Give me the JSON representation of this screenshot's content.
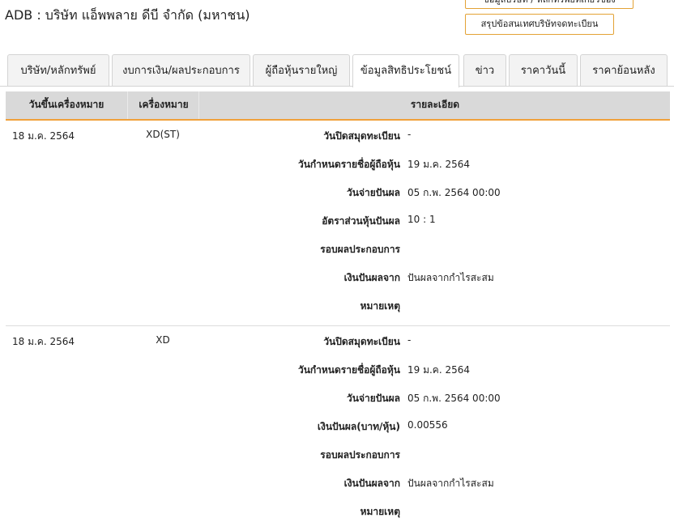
{
  "header": {
    "title": "ADB : บริษัท แอ็พพลาย ดีบี จำกัด (มหาชน)",
    "button_top": "ข้อมูลบริษัท / หลักทรัพย์ที่เกี่ยวข้อง",
    "button_summary": "สรุปข้อสนเทศบริษัทจดทะเบียน"
  },
  "tabs": [
    {
      "label": "บริษัท/หลักทรัพย์"
    },
    {
      "label": "งบการเงิน/ผลประกอบการ"
    },
    {
      "label": "ผู้ถือหุ้นรายใหญ่"
    },
    {
      "label": "ข้อมูลสิทธิประโยชน์",
      "active": true
    },
    {
      "label": "ข่าว"
    },
    {
      "label": "ราคาวันนี้"
    },
    {
      "label": "ราคาย้อนหลัง"
    }
  ],
  "table": {
    "headers": [
      "วันขึ้นเครื่องหมาย",
      "เครื่องหมาย",
      "รายละเอียด"
    ],
    "records": [
      {
        "date": "18 ม.ค. 2564",
        "symbol": "XD(ST)",
        "details": [
          {
            "label": "วันปิดสมุดทะเบียน",
            "value": "-"
          },
          {
            "label": "วันกำหนดรายชื่อผู้ถือหุ้น",
            "value": "19 ม.ค. 2564"
          },
          {
            "label": "วันจ่ายปันผล",
            "value": "05 ก.พ. 2564 00:00"
          },
          {
            "label": "อัตราส่วนหุ้นปันผล",
            "value": "10 : 1"
          },
          {
            "label": "รอบผลประกอบการ",
            "value": ""
          },
          {
            "label": "เงินปันผลจาก",
            "value": "ปันผลจากกำไรสะสม"
          },
          {
            "label": "หมายเหตุ",
            "value": ""
          }
        ]
      },
      {
        "date": "18 ม.ค. 2564",
        "symbol": "XD",
        "details": [
          {
            "label": "วันปิดสมุดทะเบียน",
            "value": "-"
          },
          {
            "label": "วันกำหนดรายชื่อผู้ถือหุ้น",
            "value": "19 ม.ค. 2564"
          },
          {
            "label": "วันจ่ายปันผล",
            "value": "05 ก.พ. 2564 00:00"
          },
          {
            "label": "เงินปันผล(บาท/หุ้น)",
            "value": "0.00556"
          },
          {
            "label": "รอบผลประกอบการ",
            "value": ""
          },
          {
            "label": "เงินปันผลจาก",
            "value": "ปันผลจากกำไรสะสม"
          },
          {
            "label": "หมายเหตุ",
            "value": ""
          }
        ]
      }
    ]
  },
  "colors": {
    "accent": "#f0a03a",
    "button_border": "#e3a235",
    "header_bg": "#d9d9d9",
    "tab_bg": "#f3f3f3"
  }
}
